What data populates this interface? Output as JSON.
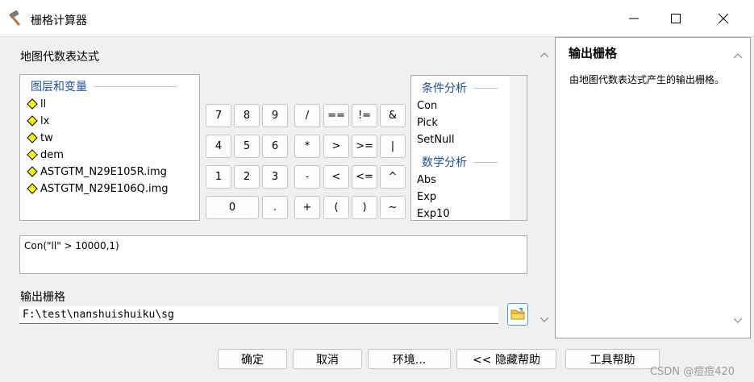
{
  "window": {
    "title": "栅格计算器",
    "icon": "hammer-icon"
  },
  "left": {
    "expression_label": "地图代数表达式",
    "layers_header": "图层和变量",
    "layers": [
      "ll",
      "lx",
      "tw",
      "dem",
      "ASTGTM_N29E105R.img",
      "ASTGTM_N29E106Q.img"
    ],
    "calc_buttons": [
      [
        "7",
        "8",
        "9",
        "/",
        "==",
        "!=",
        "&"
      ],
      [
        "4",
        "5",
        "6",
        "*",
        ">",
        ">=",
        "|"
      ],
      [
        "1",
        "2",
        "3",
        "-",
        "<",
        "<=",
        "^"
      ],
      [
        "0",
        ".",
        "+",
        "(",
        ")",
        "~"
      ]
    ],
    "functions": {
      "group1_header": "条件分析",
      "group1_items": [
        "Con",
        "Pick",
        "SetNull"
      ],
      "group2_header": "数学分析",
      "group2_items": [
        "Abs",
        "Exp",
        "Exp10"
      ]
    },
    "expression": "Con(\"ll\" > 10000,1)",
    "output_label": "输出栅格",
    "output_path": "F:\\test\\nanshuishuiku\\sg"
  },
  "help": {
    "title": "输出栅格",
    "text": "由地图代数表达式产生的输出栅格。"
  },
  "buttons": {
    "ok": "确定",
    "cancel": "取消",
    "env": "环境...",
    "hide_help": "<< 隐藏帮助",
    "tool_help": "工具帮助"
  },
  "watermark": "CSDN @痘痘420",
  "colors": {
    "group_header": "#1e50a2",
    "diamond_fill": "#ffff00",
    "folder_border": "#4aa0dc"
  }
}
